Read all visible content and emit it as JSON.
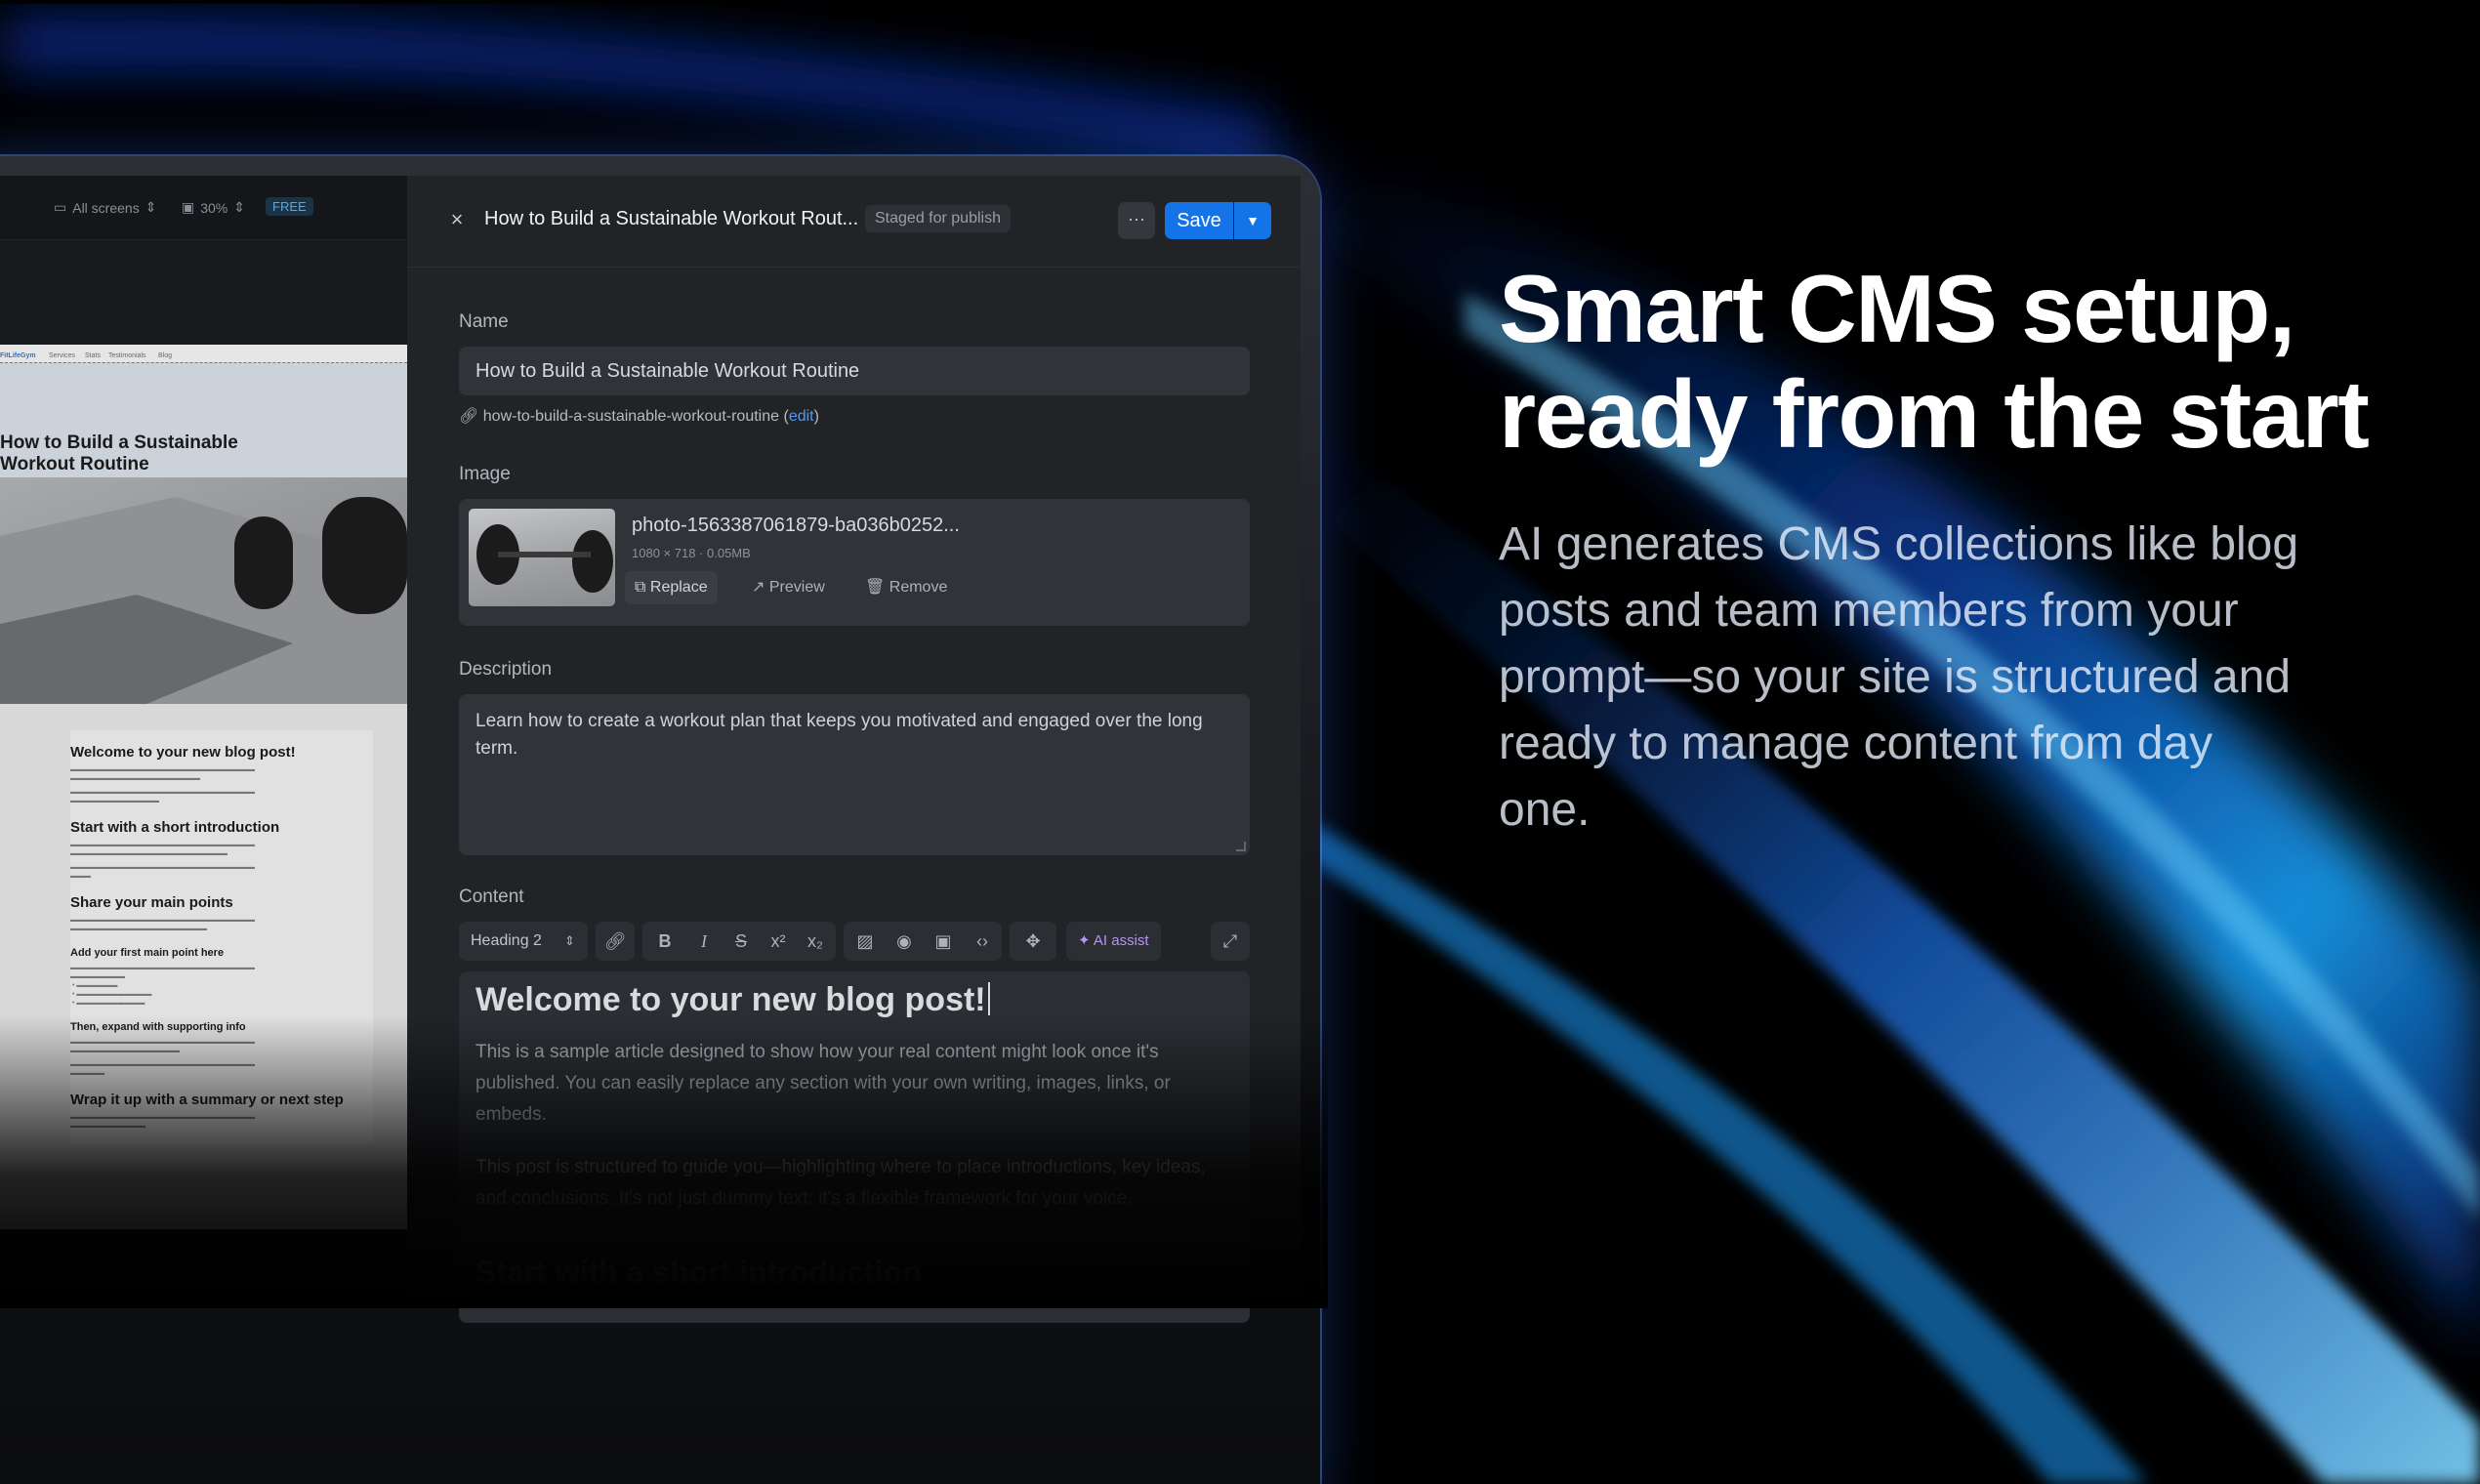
{
  "hero": {
    "title_line1": "Smart CMS setup,",
    "title_line2": "ready from the start",
    "subtitle": "AI generates CMS collections like blog posts and team members from your prompt—so your site is structured and ready to manage content from day one."
  },
  "canvas": {
    "screens_label": "All screens",
    "zoom_label": "30%",
    "plan_badge": "FREE",
    "preview": {
      "brand": "FitLifeGym",
      "nav": [
        "Services",
        "Stats",
        "Testimonials",
        "Blog"
      ],
      "hero_title": "How to Build a Sustainable Workout Routine",
      "sections": [
        {
          "heading": "Welcome to your new blog post!",
          "size": 15
        },
        {
          "heading": "Start with a short introduction",
          "size": 15
        },
        {
          "heading": "Share your main points",
          "size": 15
        },
        {
          "heading": "Add your first main point here",
          "size": 11
        },
        {
          "heading": "Then, expand with supporting info",
          "size": 11
        },
        {
          "heading": "Wrap it up with a summary or next step",
          "size": 15
        }
      ]
    }
  },
  "panel": {
    "title": "How to Build a Sustainable Workout Rout...",
    "status": "Staged for publish",
    "more_label": "···",
    "save_label": "Save",
    "name": {
      "label": "Name",
      "value": "How to Build a Sustainable Workout Routine",
      "slug": "how-to-build-a-sustainable-workout-routine",
      "slug_edit": "edit"
    },
    "image": {
      "label": "Image",
      "file_name": "photo-1563387061879-ba036b0252...",
      "dimensions": "1080 × 718",
      "size": "0.05MB",
      "replace": "Replace",
      "preview": "Preview",
      "remove": "Remove"
    },
    "description": {
      "label": "Description",
      "value": "Learn how to create a workout plan that keeps you motivated and engaged over the long term."
    },
    "content": {
      "label": "Content",
      "block_type": "Heading 2",
      "ai_assist": "AI assist",
      "heading": "Welcome to your new blog post!",
      "para1": "This is a sample article designed to show how your real content might look once it's published. You can easily replace any section with your own writing, images, links, or embeds.",
      "para2": "This post is structured to guide you—highlighting where to place introductions, key ideas, and conclusions. It's not just dummy text; it's a flexible framework for your voice.",
      "subheading": "Start with a short introduction"
    }
  }
}
